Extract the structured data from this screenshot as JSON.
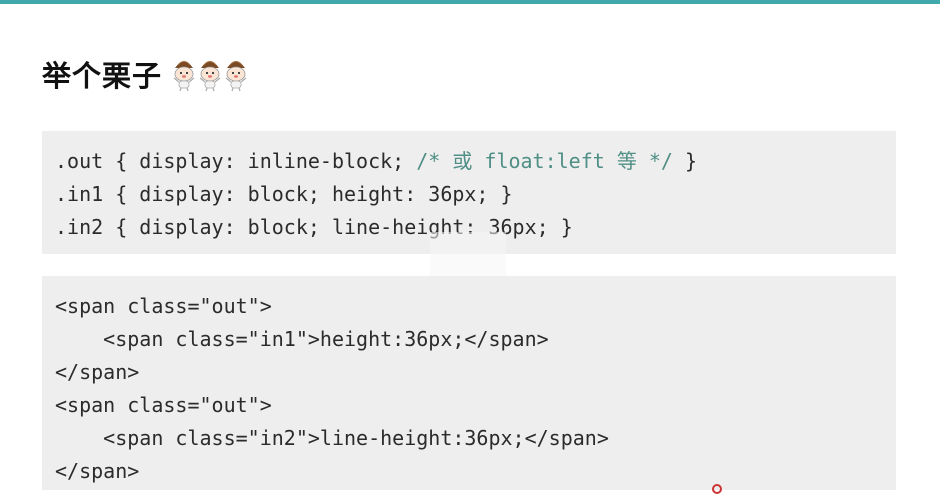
{
  "colors": {
    "accent_bar": "#3fa9ac",
    "code_background": "#eeeeee",
    "comment_text": "#4f8f86"
  },
  "heading": {
    "title": "举个栗子",
    "icons": [
      "chestnut-emoji-icon",
      "chestnut-emoji-icon",
      "chestnut-emoji-icon"
    ]
  },
  "css_code": {
    "lines": [
      {
        "code": ".out { display: inline-block; ",
        "comment": "/* 或 float:left 等 */",
        "tail": " }"
      },
      {
        "code": ".in1 { display: block; height: 36px; }",
        "comment": "",
        "tail": ""
      },
      {
        "code": ".in2 { display: block; line-height: 36px; }",
        "comment": "",
        "tail": ""
      }
    ]
  },
  "html_code": {
    "lines": [
      "<span class=\"out\">",
      "    <span class=\"in1\">height:36px;</span>",
      "</span>",
      "<span class=\"out\">",
      "    <span class=\"in2\">line-height:36px;</span>",
      "</span>"
    ]
  }
}
